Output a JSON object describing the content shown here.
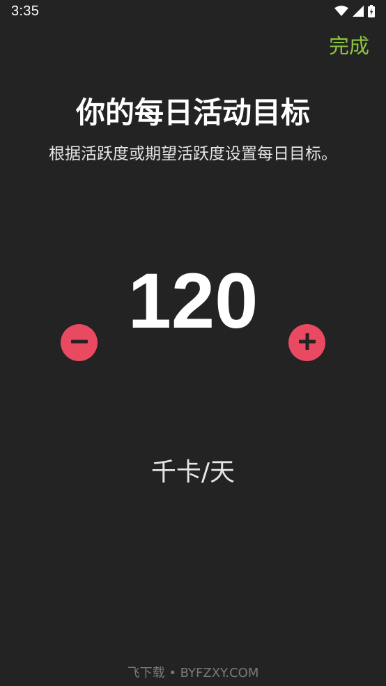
{
  "status_bar": {
    "time": "3:35",
    "icons": [
      "wifi-icon",
      "cell-signal-icon",
      "battery-icon"
    ]
  },
  "header": {
    "done_label": "完成"
  },
  "main": {
    "title": "你的每日活动目标",
    "subtitle": "根据活跃度或期望活跃度设置每日目标。",
    "goal_value": "120",
    "goal_unit": "千卡/天",
    "decrement_icon": "minus-icon",
    "increment_icon": "plus-icon"
  },
  "watermark": "飞下载 • BYFZXY.COM",
  "colors": {
    "background": "#232323",
    "accent_green": "#8cc63f",
    "button_red": "#e94a62",
    "text_primary": "#ffffff"
  }
}
